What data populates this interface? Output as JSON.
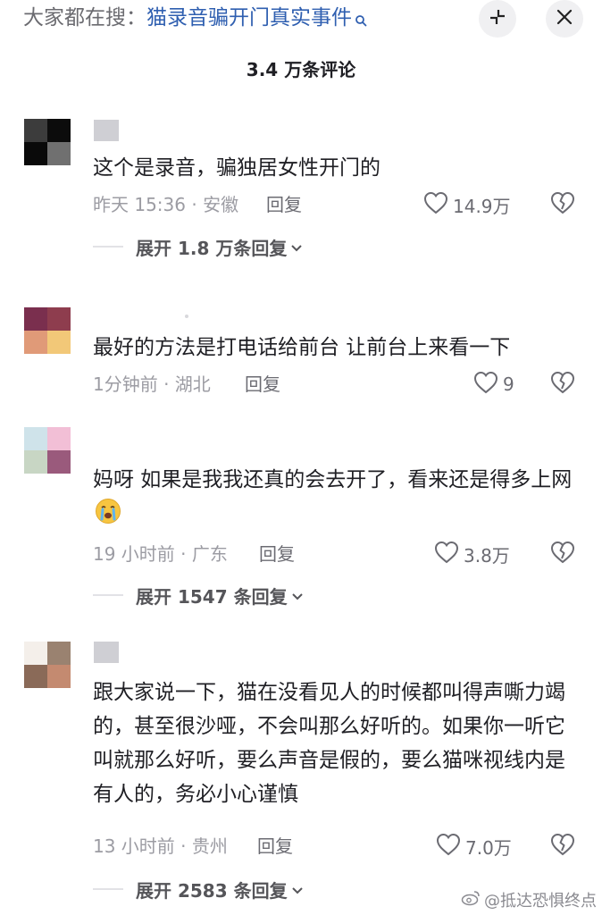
{
  "search_bar": {
    "prefix": "大家都在搜：",
    "query": "猫录音骗开门真实事件"
  },
  "comments_header": {
    "title": "3.4 万条评论"
  },
  "comments": [
    {
      "avatar_colors": [
        "#3c3c3c",
        "#0c0c0c",
        "#0a0a0a",
        "#707070"
      ],
      "text": "这个是录音，骗独居女性开门的",
      "time_location": "昨天 15:36 · 安徽",
      "reply_label": "回复",
      "likes": "14.9万",
      "expand_label": "展开 1.8 万条回复"
    },
    {
      "avatar_colors": [
        "#7a2f4e",
        "#8e3d4e",
        "#e09a78",
        "#f2c878"
      ],
      "text": "最好的方法是打电话给前台  让前台上来看一下",
      "time_location": "1分钟前 · 湖北",
      "reply_label": "回复",
      "likes": "9"
    },
    {
      "avatar_colors": [
        "#cfe3ea",
        "#f2bfd6",
        "#c8d6c4",
        "#9a5a7c"
      ],
      "text": "妈呀 如果是我我还真的会去开了，看来还是得多上网",
      "emoji": "crying-face",
      "time_location": "19 小时前 · 广东",
      "reply_label": "回复",
      "likes": "3.8万",
      "expand_label": "展开 1547 条回复"
    },
    {
      "avatar_colors": [
        "#f4efea",
        "#9a8270",
        "#8a6a58",
        "#c48a70"
      ],
      "text": "跟大家说一下，猫在没看见人的时候都叫得声嘶力竭的，甚至很沙哑，不会叫那么好听的。如果你一听它叫就那么好听，要么声音是假的，要么猫咪视线内是有人的，务必小心谨慎",
      "time_location": "13 小时前 · 贵州",
      "reply_label": "回复",
      "likes": "7.0万",
      "expand_label": "展开 2583 条回复"
    }
  ],
  "watermark": "@抵达恐惧终点"
}
